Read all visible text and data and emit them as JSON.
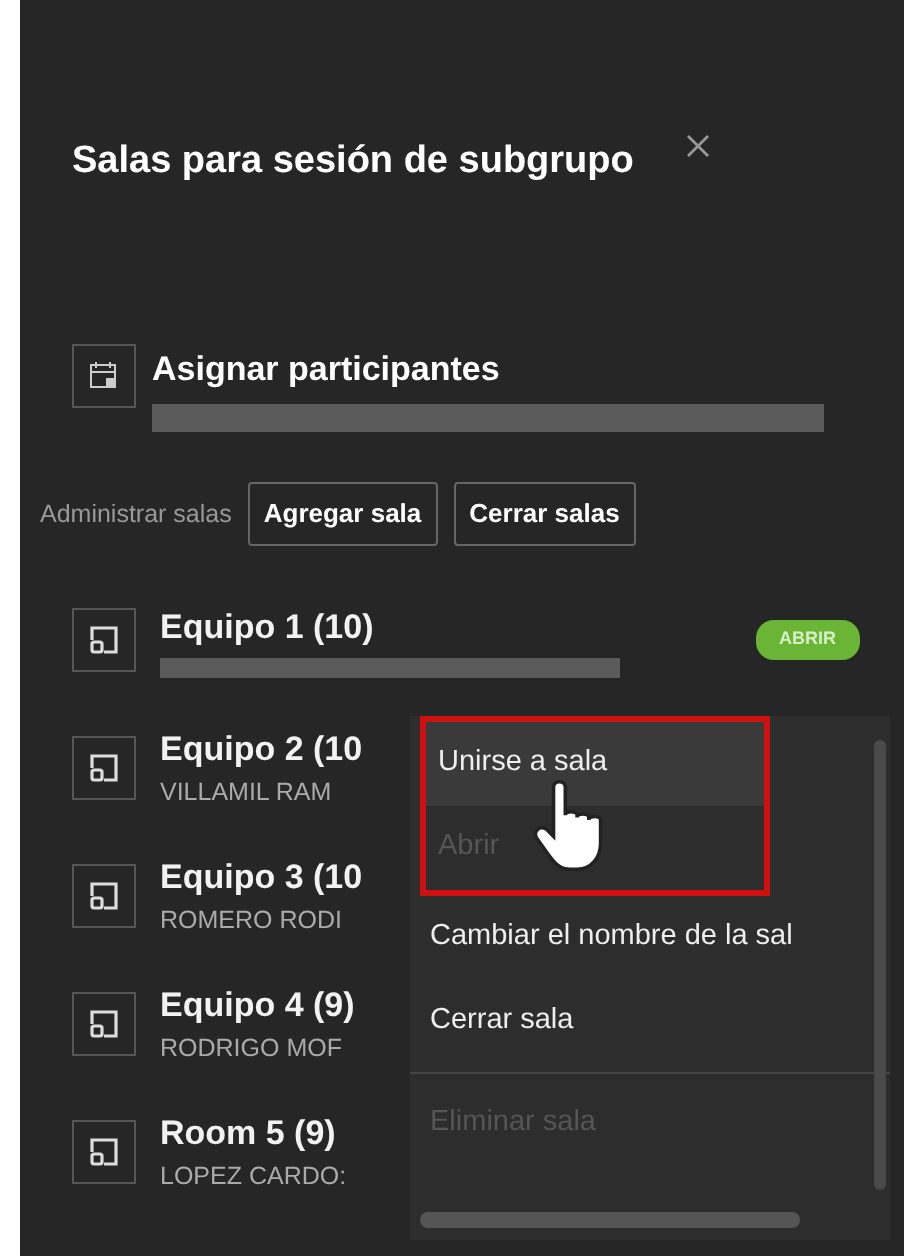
{
  "panel": {
    "title": "Salas para sesión de subgrupo"
  },
  "assign": {
    "label": "Asignar participantes"
  },
  "manage": {
    "label": "Administrar salas",
    "buttons": [
      "Agregar sala",
      "Cerrar salas"
    ]
  },
  "rooms": [
    {
      "name": "Equipo 1 (10)",
      "badge": "ABRIR"
    },
    {
      "name": "Equipo 2 (10",
      "subtitle": "VILLAMIL RAM"
    },
    {
      "name": "Equipo 3 (10",
      "subtitle": "ROMERO RODI"
    },
    {
      "name": "Equipo 4 (9)",
      "subtitle": "RODRIGO MOF"
    },
    {
      "name": "Room 5 (9)",
      "subtitle": "LOPEZ CARDO:"
    }
  ],
  "context_menu": {
    "items": [
      {
        "label": "Unirse a sala",
        "disabled": false,
        "selected": true,
        "boxed": true
      },
      {
        "label": "Abrir",
        "disabled": true,
        "selected": false,
        "boxed": true
      },
      {
        "label": "Cambiar el nombre de la sal",
        "disabled": false,
        "selected": false,
        "boxed": false
      },
      {
        "label": "Cerrar sala",
        "disabled": false,
        "selected": false,
        "boxed": false
      },
      {
        "label": "Eliminar sala",
        "disabled": true,
        "selected": false,
        "boxed": false
      }
    ]
  }
}
